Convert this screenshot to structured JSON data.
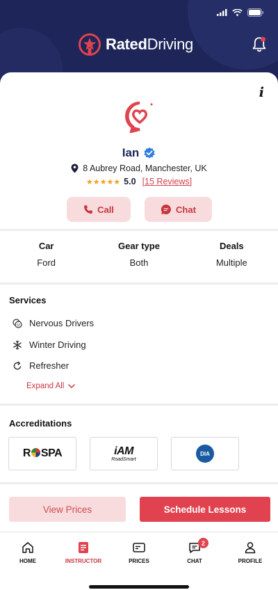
{
  "header": {
    "logo_bold": "Rated",
    "logo_regular": "Driving",
    "bell_icon": "bell-icon",
    "has_notification": true
  },
  "colors": {
    "navy": "#1d2559",
    "accent": "#e0434f",
    "accent_light": "#f8dcdd",
    "star": "#f2a01f"
  },
  "profile": {
    "info_icon": "i",
    "name": "Ian",
    "address": "8 Aubrey Road, Manchester, UK",
    "stars": "★★★★★",
    "rating": "5.0",
    "reviews": "[15 Reviews]",
    "call_label": "Call",
    "chat_label": "Chat"
  },
  "stats": [
    {
      "label": "Car",
      "value": "Ford"
    },
    {
      "label": "Gear type",
      "value": "Both"
    },
    {
      "label": "Deals",
      "value": "Multiple"
    }
  ],
  "services": {
    "title": "Services",
    "items": [
      {
        "label": "Nervous Drivers",
        "icon": "nervous-icon"
      },
      {
        "label": "Winter Driving",
        "icon": "snowflake-icon"
      },
      {
        "label": "Refresher",
        "icon": "refresh-icon"
      }
    ],
    "expand_label": "Expand All"
  },
  "accreditations": {
    "title": "Accreditations",
    "badges": [
      {
        "name": "RoSPA",
        "text_left": "R",
        "text_right": "SPA"
      },
      {
        "name": "IAM RoadSmart",
        "big": "iAM",
        "small": "RoadSmart"
      },
      {
        "name": "DIA",
        "text": "DIA"
      }
    ]
  },
  "actions": {
    "view_prices": "View Prices",
    "schedule": "Schedule Lessons"
  },
  "tabbar": {
    "items": [
      {
        "label": "HOME",
        "icon": "home-icon"
      },
      {
        "label": "INSTRUCTOR",
        "icon": "instructor-icon",
        "active": true
      },
      {
        "label": "PRICES",
        "icon": "prices-icon"
      },
      {
        "label": "CHAT",
        "icon": "chat-icon",
        "badge": "2"
      },
      {
        "label": "PROFILE",
        "icon": "profile-icon"
      }
    ]
  }
}
